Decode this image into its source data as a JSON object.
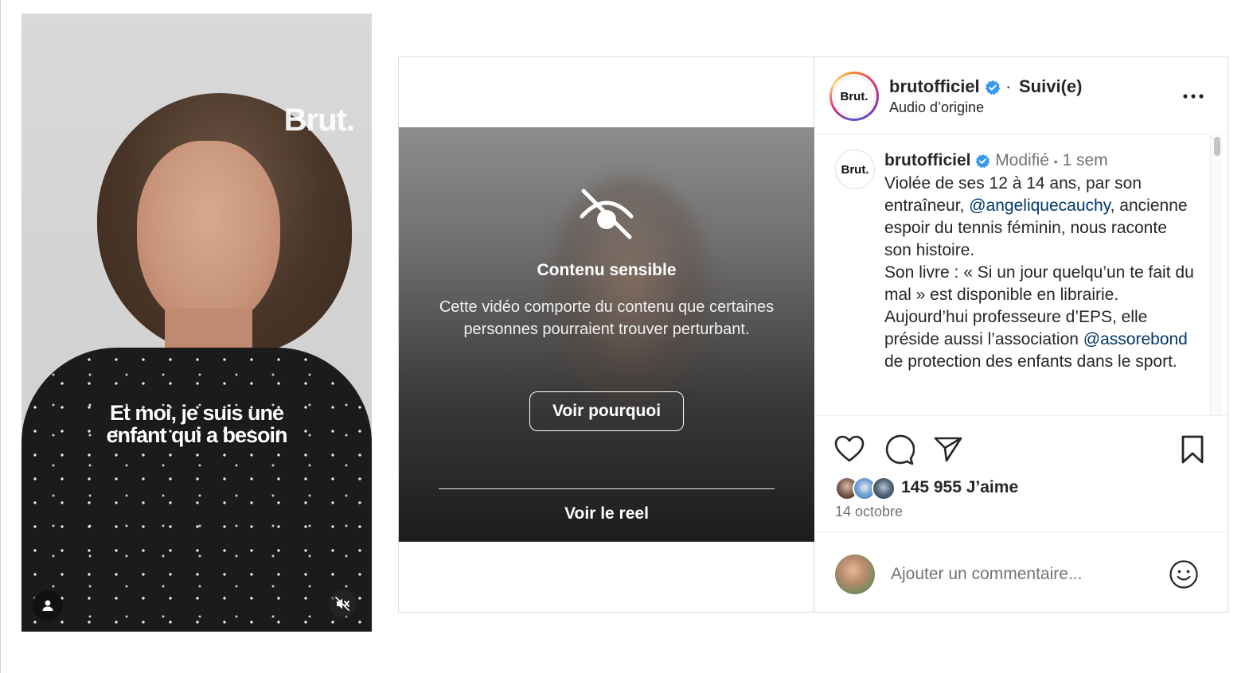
{
  "reel_preview": {
    "brand_watermark": "Brut.",
    "caption_line1": "Et moi, je suis une",
    "caption_line2": "enfant qui a besoin",
    "user_icon": "user-icon",
    "mute_icon": "speaker-muted-icon"
  },
  "media": {
    "warning_icon": "eye-slash-icon",
    "warning_title": "Contenu sensible",
    "warning_text": "Cette vidéo comporte du contenu que certaines personnes pourraient trouver perturbant.",
    "why_button": "Voir pourquoi",
    "see_reel": "Voir le reel"
  },
  "header": {
    "username": "brutofficiel",
    "separator": "·",
    "follow_status": "Suivi(e)",
    "audio": "Audio d’origine",
    "avatar_label": "Brut.",
    "more_icon": "more-icon"
  },
  "caption": {
    "avatar_label": "Brut.",
    "username": "brutofficiel",
    "edited": "Modifié",
    "dot": "•",
    "time": "1 sem",
    "text_1": "Violée de ses 12 à 14 ans, par son entraîneur, ",
    "mention_1": "@angeliquecauchy",
    "text_2": ", ancienne espoir du tennis féminin, nous raconte son histoire.",
    "text_3": "Son livre : « Si un jour quelqu’un te fait du mal » est disponible en librairie.",
    "text_4": "Aujourd’hui professeure d’EPS, elle préside aussi l’association ",
    "mention_2": "@assorebond",
    "text_5": " de protection des enfants dans le sport."
  },
  "actions": {
    "like_icon": "heart-icon",
    "comment_icon": "comment-icon",
    "share_icon": "share-icon",
    "save_icon": "bookmark-icon",
    "likes": "145 955 J’aime",
    "date": "14 octobre"
  },
  "comment": {
    "placeholder": "Ajouter un commentaire...",
    "emoji_icon": "emoji-icon"
  },
  "colors": {
    "verified_blue": "#3897f0",
    "mention": "#00376b",
    "muted_text": "#737373",
    "border": "#dbdbdb"
  }
}
